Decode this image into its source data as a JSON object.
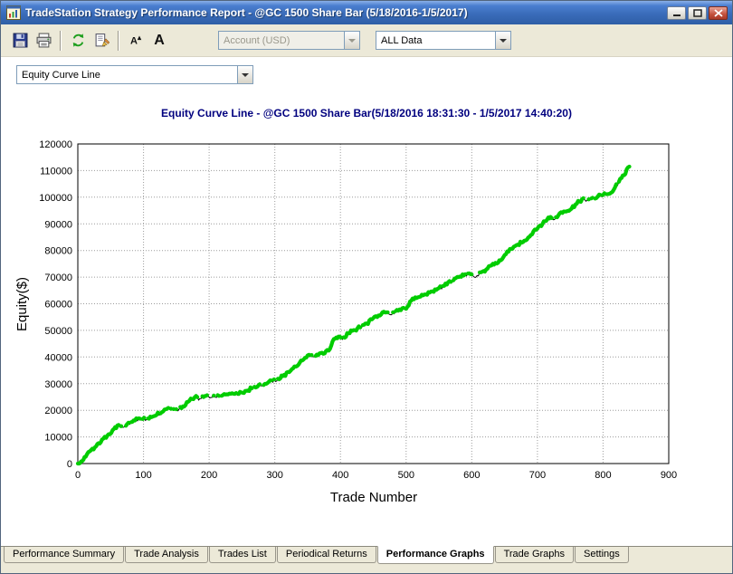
{
  "window": {
    "title": "TradeStation Strategy Performance Report - @GC 1500 Share Bar (5/18/2016-1/5/2017)"
  },
  "toolbar": {
    "icons": [
      "save-icon",
      "print-icon",
      "refresh-report-icon",
      "edit-report-icon",
      "font-decrease-icon",
      "font-increase-icon"
    ],
    "font_small_label": "A",
    "font_small_caret": "▴",
    "font_big_label": "A",
    "account_dropdown": {
      "value": "Account (USD)",
      "disabled": true
    },
    "data_dropdown": {
      "value": "ALL Data"
    }
  },
  "graph_selector": {
    "value": "Equity Curve Line"
  },
  "chart_data": {
    "type": "line",
    "title": "Equity Curve Line - @GC 1500 Share Bar(5/18/2016 18:31:30 - 1/5/2017 14:40:20)",
    "xlabel": "Trade Number",
    "ylabel": "Equity($)",
    "xlim": [
      0,
      900
    ],
    "ylim": [
      0,
      120000
    ],
    "xtick": 100,
    "ytick": 10000,
    "grid": true,
    "legend": "none",
    "colors": {
      "new_high": "#00cc00",
      "drawdown": "#000000",
      "title": "#00007f"
    },
    "points": [
      [
        0,
        0
      ],
      [
        5,
        800
      ],
      [
        12,
        2500
      ],
      [
        20,
        5000
      ],
      [
        28,
        6500
      ],
      [
        35,
        8000
      ],
      [
        45,
        10500
      ],
      [
        55,
        13000
      ],
      [
        62,
        14500
      ],
      [
        68,
        13600
      ],
      [
        75,
        14800
      ],
      [
        85,
        16200
      ],
      [
        95,
        16800
      ],
      [
        105,
        16600
      ],
      [
        112,
        17400
      ],
      [
        120,
        18300
      ],
      [
        128,
        19300
      ],
      [
        136,
        20600
      ],
      [
        144,
        20100
      ],
      [
        152,
        19800
      ],
      [
        160,
        21500
      ],
      [
        170,
        23600
      ],
      [
        178,
        24900
      ],
      [
        186,
        24400
      ],
      [
        195,
        25400
      ],
      [
        205,
        24900
      ],
      [
        215,
        25400
      ],
      [
        225,
        25900
      ],
      [
        235,
        26400
      ],
      [
        245,
        26100
      ],
      [
        255,
        27300
      ],
      [
        265,
        28200
      ],
      [
        275,
        29300
      ],
      [
        285,
        29900
      ],
      [
        295,
        31200
      ],
      [
        303,
        31000
      ],
      [
        312,
        32800
      ],
      [
        322,
        34300
      ],
      [
        332,
        36400
      ],
      [
        342,
        38700
      ],
      [
        350,
        40600
      ],
      [
        358,
        40100
      ],
      [
        366,
        40700
      ],
      [
        374,
        41200
      ],
      [
        382,
        42400
      ],
      [
        390,
        46800
      ],
      [
        397,
        47700
      ],
      [
        403,
        46600
      ],
      [
        412,
        48900
      ],
      [
        420,
        50100
      ],
      [
        430,
        51100
      ],
      [
        440,
        52600
      ],
      [
        450,
        54600
      ],
      [
        458,
        55600
      ],
      [
        468,
        56700
      ],
      [
        476,
        55900
      ],
      [
        484,
        57200
      ],
      [
        492,
        57600
      ],
      [
        500,
        58100
      ],
      [
        508,
        61200
      ],
      [
        518,
        62400
      ],
      [
        528,
        63500
      ],
      [
        538,
        64600
      ],
      [
        548,
        65600
      ],
      [
        558,
        66700
      ],
      [
        568,
        68200
      ],
      [
        578,
        70100
      ],
      [
        588,
        70600
      ],
      [
        598,
        71100
      ],
      [
        606,
        69900
      ],
      [
        614,
        71800
      ],
      [
        624,
        73200
      ],
      [
        634,
        74700
      ],
      [
        644,
        76300
      ],
      [
        652,
        78600
      ],
      [
        660,
        80600
      ],
      [
        670,
        82200
      ],
      [
        680,
        83700
      ],
      [
        690,
        85800
      ],
      [
        700,
        88200
      ],
      [
        708,
        90100
      ],
      [
        715,
        91700
      ],
      [
        720,
        92600
      ],
      [
        726,
        91600
      ],
      [
        732,
        93200
      ],
      [
        738,
        94100
      ],
      [
        744,
        94600
      ],
      [
        752,
        95700
      ],
      [
        760,
        97600
      ],
      [
        768,
        99300
      ],
      [
        776,
        99000
      ],
      [
        784,
        99800
      ],
      [
        792,
        100300
      ],
      [
        800,
        100800
      ],
      [
        810,
        101300
      ],
      [
        818,
        103600
      ],
      [
        828,
        107200
      ],
      [
        840,
        111500
      ]
    ]
  },
  "tabs": {
    "active": "Performance Graphs",
    "items": [
      {
        "label": "Performance Summary"
      },
      {
        "label": "Trade Analysis"
      },
      {
        "label": "Trades List"
      },
      {
        "label": "Periodical Returns"
      },
      {
        "label": "Performance Graphs"
      },
      {
        "label": "Trade Graphs"
      },
      {
        "label": "Settings"
      }
    ]
  }
}
